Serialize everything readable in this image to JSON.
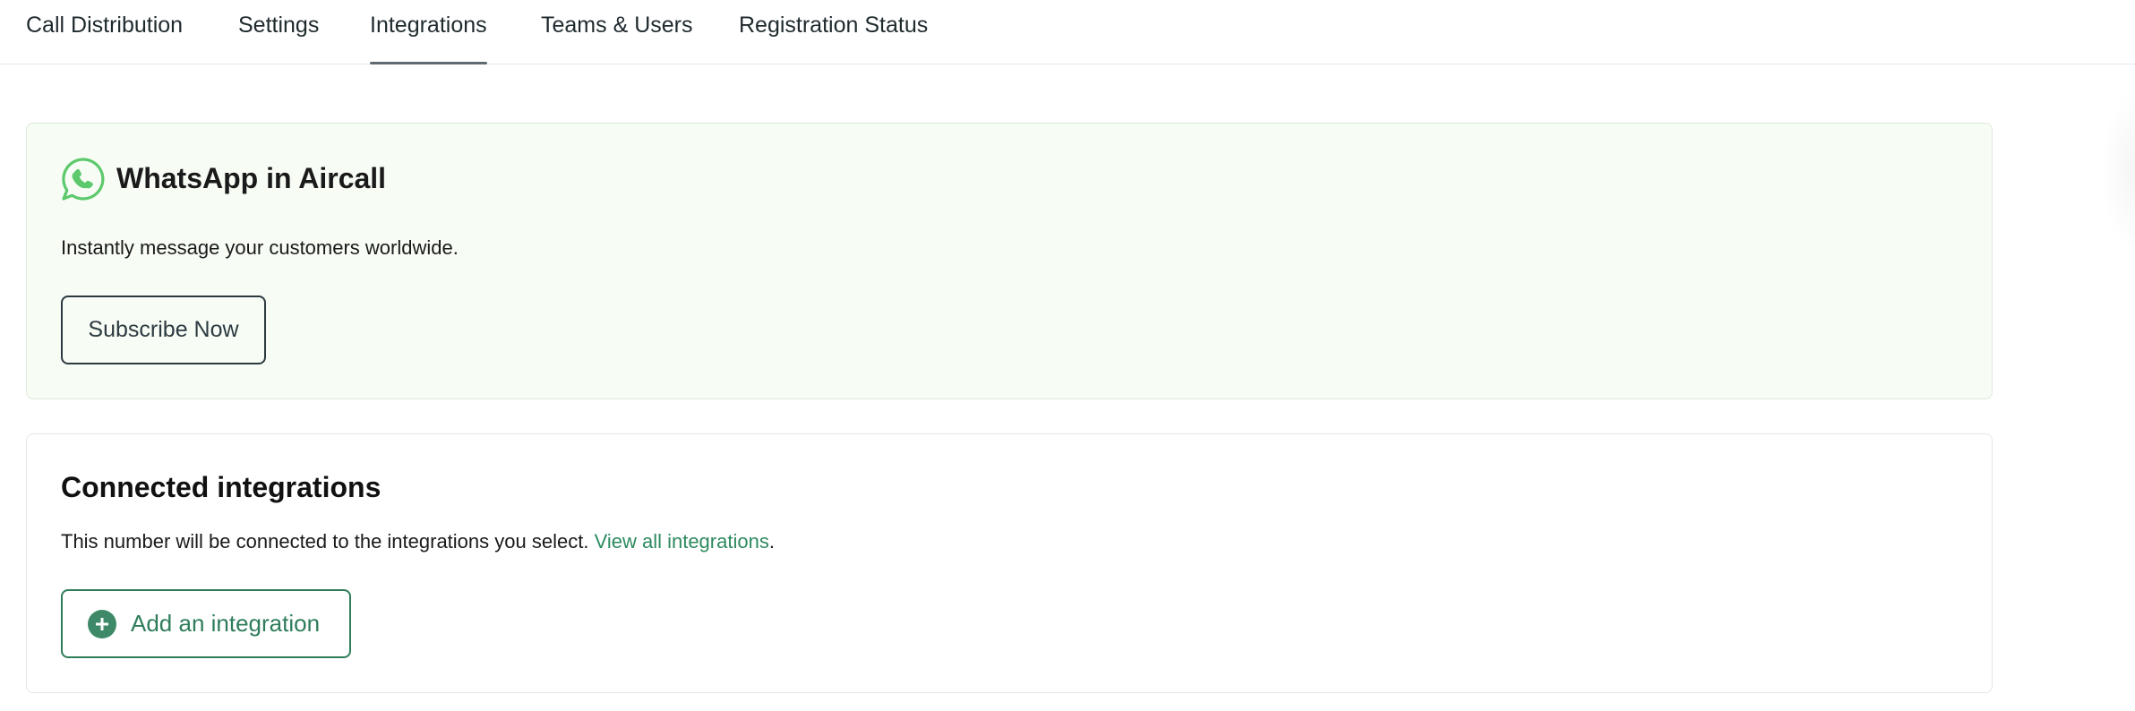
{
  "tabs": [
    {
      "label": "Call Distribution",
      "active": false
    },
    {
      "label": "Settings",
      "active": false
    },
    {
      "label": "Integrations",
      "active": true
    },
    {
      "label": "Teams & Users",
      "active": false
    },
    {
      "label": "Registration Status",
      "active": false
    }
  ],
  "whatsapp_card": {
    "icon": "whatsapp-icon",
    "title": "WhatsApp in Aircall",
    "description": "Instantly message your customers worldwide.",
    "button_label": "Subscribe Now"
  },
  "integrations_card": {
    "title": "Connected integrations",
    "description": "This number will be connected to the integrations you select.",
    "link_label": "View all integrations",
    "link_suffix": ".",
    "button_icon": "plus-circle-icon",
    "button_label": "Add an integration"
  },
  "colors": {
    "accent_green": "#2e7d5a",
    "whatsapp_green": "#5cc96c",
    "card_bg_green": "#f7fcf5"
  }
}
